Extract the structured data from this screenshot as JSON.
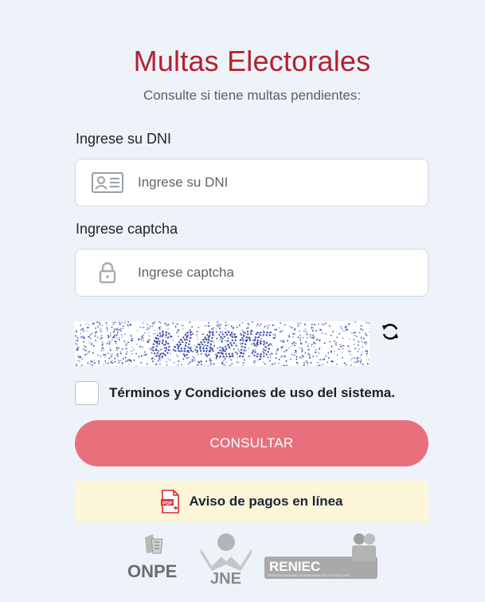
{
  "header": {
    "title": "Multas Electorales",
    "subtitle": "Consulte si tiene multas pendientes:"
  },
  "dni": {
    "label": "Ingrese su DNI",
    "placeholder": "Ingrese su DNI",
    "icon": "id-card-icon"
  },
  "captcha_field": {
    "label": "Ingrese captcha",
    "placeholder": "Ingrese captcha",
    "icon": "lock-icon"
  },
  "captcha_image": {
    "code": "6442f5",
    "refresh_icon": "refresh-icon"
  },
  "terms": {
    "text": "Términos y Condiciones de uso del sistema.",
    "checked": false
  },
  "submit": {
    "label": "CONSULTAR"
  },
  "notice": {
    "text": "Aviso de pagos en línea",
    "icon": "pdf-icon"
  },
  "logos": {
    "onpe": "ONPE",
    "jne": "JNE",
    "reniec": "RENIEC",
    "reniec_caption": "REGISTRO NACIONAL DE IDENTIFICACIÓN Y ESTADO CIVIL"
  },
  "colors": {
    "title": "#b5202e",
    "button": "#e8707c",
    "notice_bg": "#fdf5d8",
    "page_bg": "#eef3fa"
  }
}
